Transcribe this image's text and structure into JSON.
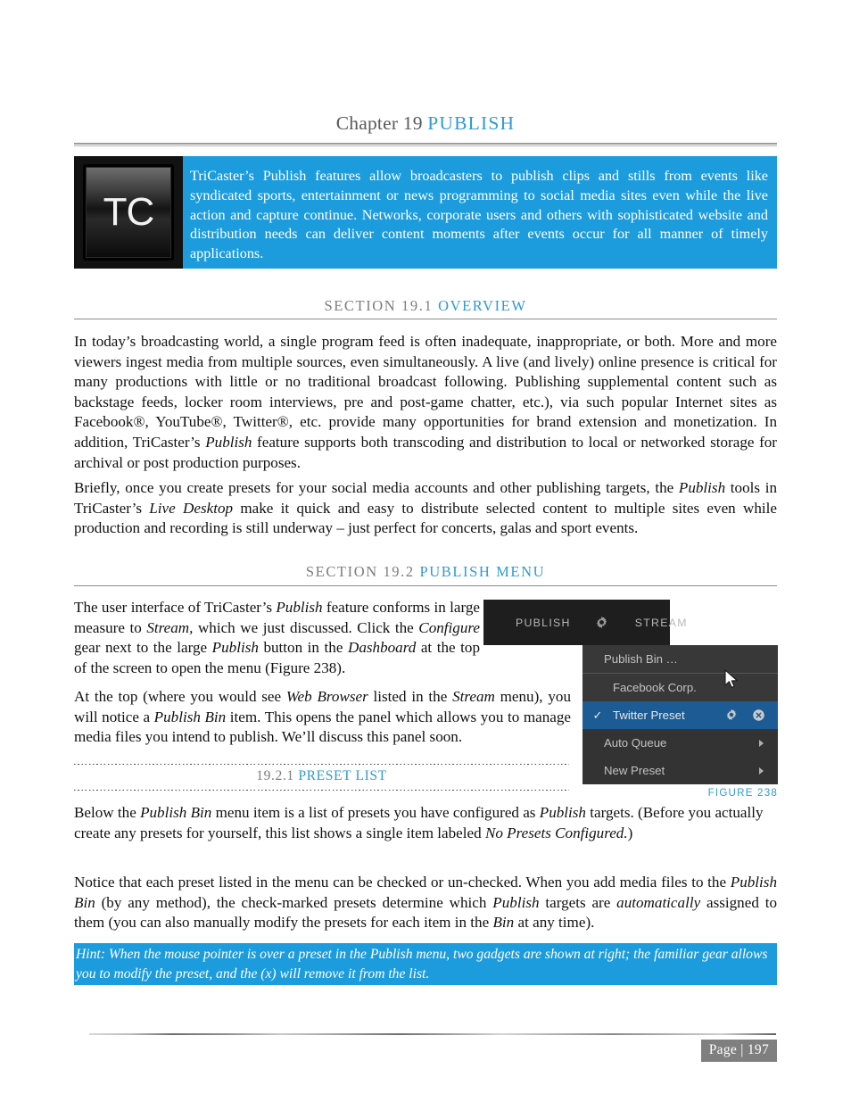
{
  "chapter": {
    "prefix": "Chapter 19",
    "keyword": "PUBLISH"
  },
  "intro": {
    "logo_text": "TC",
    "text": "TriCaster’s Publish features allow broadcasters to publish clips and stills from events like syndicated sports, entertainment or news programming to social media sites even while the live action and capture continue.  Networks, corporate users and others with sophisticated website and distribution needs can deliver content moments after events occur for all manner of timely applications."
  },
  "section_19_1": {
    "number": "SECTION 19.1",
    "title": "OVERVIEW",
    "paragraph_1_html": "In today’s broadcasting world, a single program feed is often inadequate, inappropriate, or both. More and more viewers ingest media from multiple sources, even simultaneously. A live (and lively) online presence is critical for many productions with little or no traditional broadcast following. Publishing supplemental content such as backstage feeds, locker room interviews, pre and post-game chatter, etc.), via such popular Internet sites as Facebook®, YouTube®, Twitter®, etc. provide many opportunities for brand extension and monetization.  In addition, TriCaster’s <i>Publish</i> feature supports both transcoding and distribution to local or networked storage for archival or post production purposes.",
    "paragraph_2_html": "Briefly, once you create presets for your social media accounts and other publishing targets, the <i>Publish</i> tools in TriCaster’s <i>Live Desktop</i> make it quick and easy to distribute selected content to multiple sites even while production and recording is still underway – just perfect for concerts, galas and sport events."
  },
  "section_19_2": {
    "number": "SECTION 19.2",
    "title": "PUBLISH MENU",
    "paragraph_1_html": "The user interface of TriCaster’s <i>Publish</i> feature conforms in large measure to <i>Stream,</i> which we just discussed.  Click the <i>Configure</i> gear next to the large <i>Publish</i> button in the <i>Dashboard</i> at the top of the screen to open the menu (Figure 238).",
    "paragraph_2_html": "At the top (where you would see <i>Web Browser</i> listed in the <i>Stream</i> menu), you will notice a <i>Publish Bin</i> item.  This opens the panel which allows you to manage media files you intend to publish.  We’ll discuss this panel soon."
  },
  "subsection_19_2_1": {
    "number": "19.2.1",
    "title": "PRESET LIST",
    "paragraph_1_html": "Below the <i>Publish Bin</i> menu item is a list of presets you have configured as <i>Publish</i> targets.  (Before you actually create any presets for yourself, this list shows a single item labeled <i>No Presets Configured.</i>)",
    "paragraph_2_html": "Notice that each preset listed in the menu can be checked or un-checked.  When you add media files to the <i>Publish Bin</i> (by any method), the check-marked presets determine which <i>Publish</i> targets are <i>automatically</i> assigned to them (you can also manually modify the presets for each item in the <i>Bin</i> at any time)."
  },
  "hint": {
    "text": "Hint: When the mouse pointer is over a preset in the Publish menu, two gadgets are shown at right; the familiar gear allows you to modify the preset, and the (x) will remove it from the list."
  },
  "figure": {
    "caption": "FIGURE 238",
    "dashboard": {
      "publish_label": "PUBLISH",
      "gear_icon": "gear-icon",
      "stream_label": "STREAM"
    },
    "menu_items": [
      {
        "label": "Publish Bin …",
        "checked": false,
        "has_submenu": false,
        "has_gadgets": false,
        "selected": false
      },
      {
        "label": "Facebook Corp.",
        "checked": false,
        "has_submenu": false,
        "has_gadgets": false,
        "selected": false
      },
      {
        "label": "Twitter  Preset",
        "checked": true,
        "check_glyph": "✓",
        "has_submenu": false,
        "has_gadgets": true,
        "selected": true
      },
      {
        "label": "Auto Queue",
        "checked": false,
        "has_submenu": true,
        "has_gadgets": false,
        "selected": false
      },
      {
        "label": "New Preset",
        "checked": false,
        "has_submenu": true,
        "has_gadgets": false,
        "selected": false
      }
    ],
    "gadgets": {
      "gear_icon": "gear-icon",
      "close_icon": "close-circle-icon"
    },
    "cursor_icon": "mouse-pointer-icon"
  },
  "footer": {
    "page_label": "Page | 197"
  },
  "colors": {
    "accent_blue": "#2e9bd6",
    "banner_blue": "#1c9bdd",
    "menu_selected": "#1d5b94",
    "heading_gray": "#7d7d7d"
  }
}
